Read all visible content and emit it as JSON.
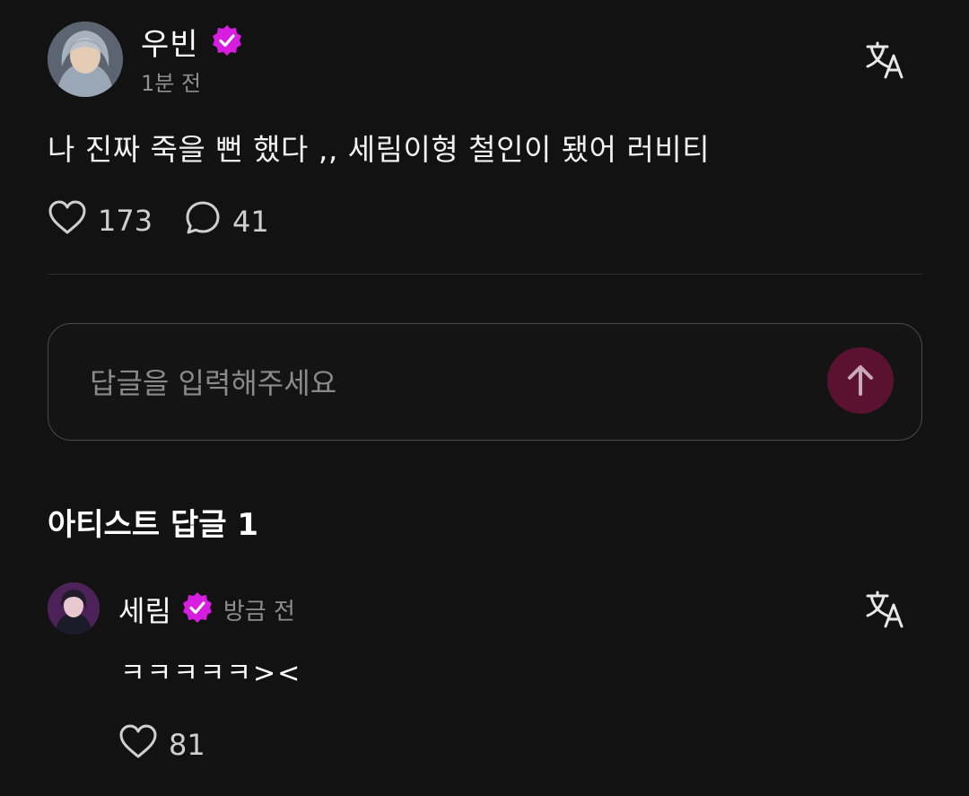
{
  "post": {
    "author": "우빈",
    "time": "1분 전",
    "text": "나 진짜 죽을 뻔 했다 ,, 세림이형 철인이 됐어 러비티",
    "likes": "173",
    "comments": "41"
  },
  "reply_input": {
    "placeholder": "답글을 입력해주세요"
  },
  "artist_replies": {
    "title": "아티스트 답글 1",
    "items": [
      {
        "author": "세림",
        "time": "방금 전",
        "text": "ㅋㅋㅋㅋㅋ><",
        "likes": "81"
      }
    ]
  },
  "colors": {
    "background": "#121212",
    "verified_badge": "#d61de0",
    "send_button": "#5a1230"
  }
}
